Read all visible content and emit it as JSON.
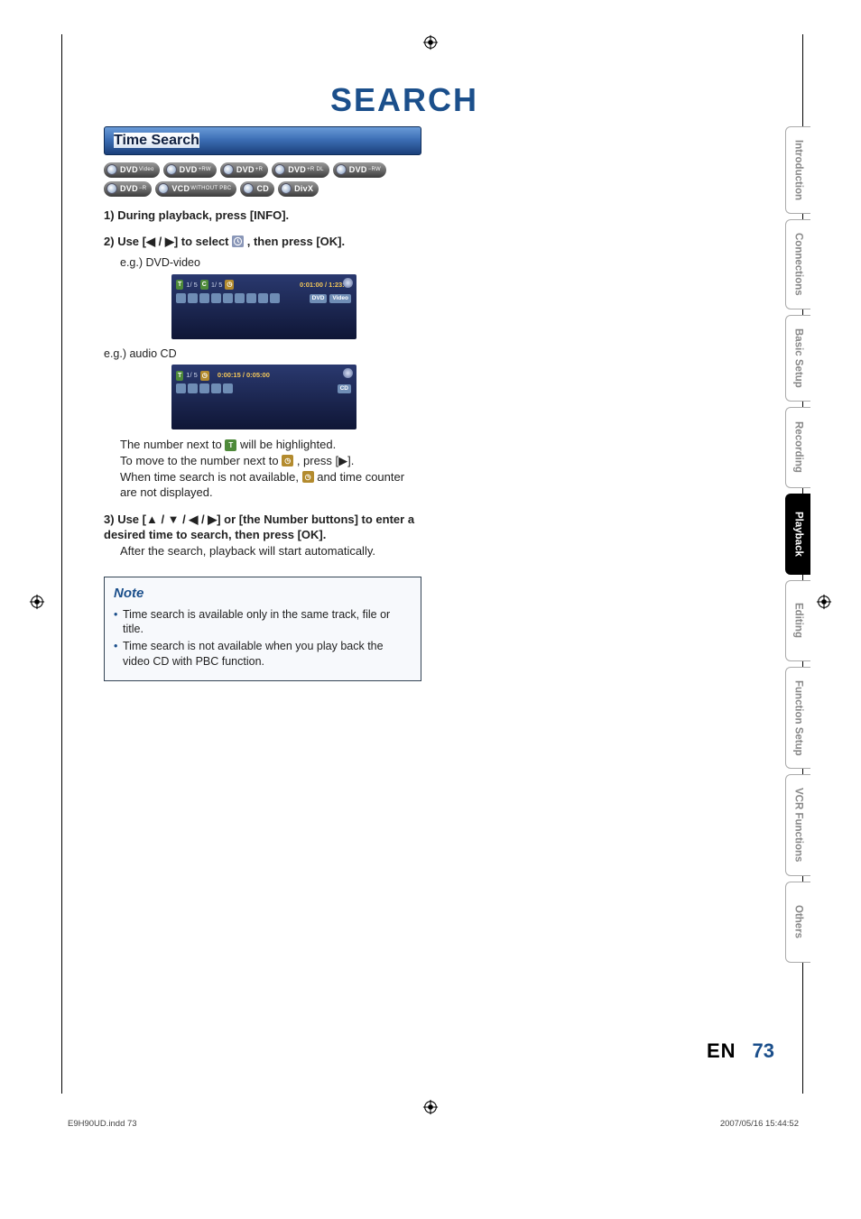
{
  "domain": "Document",
  "header": {
    "title": "SEARCH"
  },
  "section": {
    "title": "Time Search"
  },
  "badges": {
    "row": [
      "DVD Video",
      "DVD +RW",
      "DVD +R",
      "DVD +R DL",
      "DVD -RW",
      "DVD -R",
      "VCD WITHOUT PBC",
      "CD",
      "DivX"
    ]
  },
  "steps": {
    "s1": "During playback, press [INFO].",
    "s2_pre": "Use [",
    "s2_arrows": "◀ / ▶",
    "s2_mid": "] to select ",
    "s2_post": " , then press [OK].",
    "eg1": "e.g.) DVD-video",
    "eg2": "e.g.) audio CD",
    "body1_pre": "The number next to ",
    "body1_post": " will be highlighted.",
    "body2_pre": "To move to the number next to ",
    "body2_mid": " , press [",
    "body2_arrow": "▶",
    "body2_post": "].",
    "body3_pre": "When time search is not available, ",
    "body3_post": " and time counter are not displayed.",
    "s3_pre": "Use [",
    "s3_arrows": "▲ / ▼ / ◀ / ▶",
    "s3_mid": "] or [the Number buttons] to enter a desired time to search, then press [OK].",
    "s3_after": "After the search, playback will start automatically."
  },
  "screenshots": {
    "dvd": {
      "t_label": "T",
      "track": "1/  5",
      "c_label": "C",
      "chapter": "1/  5",
      "time": "0:01:00 / 1:23:45",
      "tags": [
        "DVD",
        "Video"
      ]
    },
    "cd": {
      "t_label": "T",
      "track": "1/  5",
      "time": "0:00:15 / 0:05:00",
      "tags": [
        "CD"
      ]
    }
  },
  "note": {
    "title": "Note",
    "items": [
      "Time search is available only in the same track, file or title.",
      "Time search is not available when you play back the video CD with PBC function."
    ]
  },
  "tabs": [
    "Introduction",
    "Connections",
    "Basic Setup",
    "Recording",
    "Playback",
    "Editing",
    "Function Setup",
    "VCR Functions",
    "Others"
  ],
  "active_tab": "Playback",
  "page": {
    "lang": "EN",
    "num": "73"
  },
  "footer": {
    "left": "E9H90UD.indd   73",
    "right": "2007/05/16   15:44:52"
  }
}
